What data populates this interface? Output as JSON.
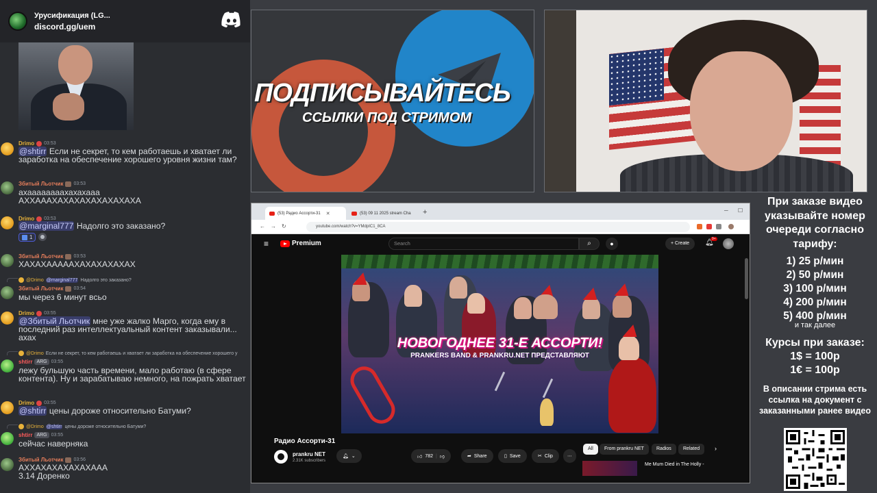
{
  "discord": {
    "server_name": "Урусификация (LG...",
    "invite": "discord.gg/uem",
    "messages": [
      {
        "author": "Drimo",
        "time": "03:53",
        "mention": "@shtirr",
        "text": " Если не секрет, то кем работаешь и хватает ли заработка на обеспечение хорошего уровня жизни там?"
      },
      {
        "author": "Збитый Льотчик",
        "time": "03:53",
        "text": "ахаааааааахахахааа\nАХХАААХАХАХАХАХАХАХАХА"
      },
      {
        "author": "Drimo",
        "time": "03:53",
        "mention": "@marginal777",
        "text": " Надолго это заказано?",
        "reaction_count": "1"
      },
      {
        "author": "Збитый Льотчик",
        "time": "03:53",
        "text": "ХАХАХАААААХАХАХАХАХАХ"
      },
      {
        "author": "Збитый Льотчик",
        "time": "03:54",
        "reply": {
          "author": "@Drimo",
          "mention": "@marginal777",
          "text": "Надолго это заказано?"
        },
        "text": "мы через 6 минут всьо"
      },
      {
        "author": "Drimo",
        "time": "03:55",
        "mention": "@Збитый Льотчик",
        "text": " мне уже жалко Марго, когда ему в последний раз интеллектуальный контент заказывали... ахах"
      },
      {
        "author": "shtirr",
        "tag": "ARG",
        "time": "03:55",
        "reply": {
          "author": "@Drimo",
          "text": "Если не секрет, то кем работаешь и хватает ли заработка на обеспечение хорошего у"
        },
        "text": "лежу бульшую часть времени, мало работаю (в сфере контента). Ну и зарабатываю немного, на пожрать хватает"
      },
      {
        "author": "Drimo",
        "time": "03:55",
        "mention": "@shtirr",
        "text": " цены дороже относительно Батуми?"
      },
      {
        "author": "shtirr",
        "tag": "ARG",
        "time": "03:55",
        "reply": {
          "author": "@Drimo",
          "mention": "@shtirr",
          "text": "цены дороже относительно Батуми?"
        },
        "text": "сейчас наверняка"
      },
      {
        "author": "Збитый Льотчик",
        "time": "03:56",
        "text": "АХХАХАХАХАХАХААА\n3.14 Доренко"
      }
    ]
  },
  "banner": {
    "title": "ПОДПИСЫВАЙТЕСЬ",
    "subtitle": "ССЫЛКИ ПОД СТРИМОМ",
    "colors": {
      "patreon": "#c6573c",
      "telegram": "#2185c9"
    }
  },
  "browser": {
    "tabs": [
      {
        "label": "(53) Радио Ассорти-31"
      },
      {
        "label": "(53) 09 11 2025 stream Cha"
      }
    ],
    "url": "youtube.com/watch?v=YMdpIC1_8CA",
    "yt": {
      "brand": "Premium",
      "search_placeholder": "Search",
      "create_label": "Create",
      "notif_badge": "9+",
      "video_title": "Радио Ассорти-31",
      "channel_name": "prankru NET",
      "channel_subs": "2.31K subscribers",
      "likes": "782",
      "share": "Share",
      "save": "Save",
      "clip": "Clip",
      "chips": [
        "All",
        "From prankru NET",
        "Radios",
        "Related"
      ],
      "suggestion_title": "Me Mum Died in The Holly -",
      "thumb_title": "НОВОГОДНЕЕ 31-Е АССОРТИ!",
      "thumb_subtitle": "PRANKERS BAND & PRANKRU.NET ПРЕДСТАВЛЯЮТ"
    }
  },
  "info_panel": {
    "heading": "При заказе видео указывайте номер очереди согласно тарифу:",
    "tariffs": [
      "1) 25 р/мин",
      "2) 50 р/мин",
      "3) 100 р/мин",
      "4) 200 р/мин",
      "5) 400 р/мин"
    ],
    "tariffs_more": "и так далее",
    "rates_heading": "Курсы при заказе:",
    "rates": [
      "1$ = 100р",
      "1€ = 100р"
    ],
    "description": "В описании стрима есть ссылка на документ с заказанными ранее видео"
  }
}
